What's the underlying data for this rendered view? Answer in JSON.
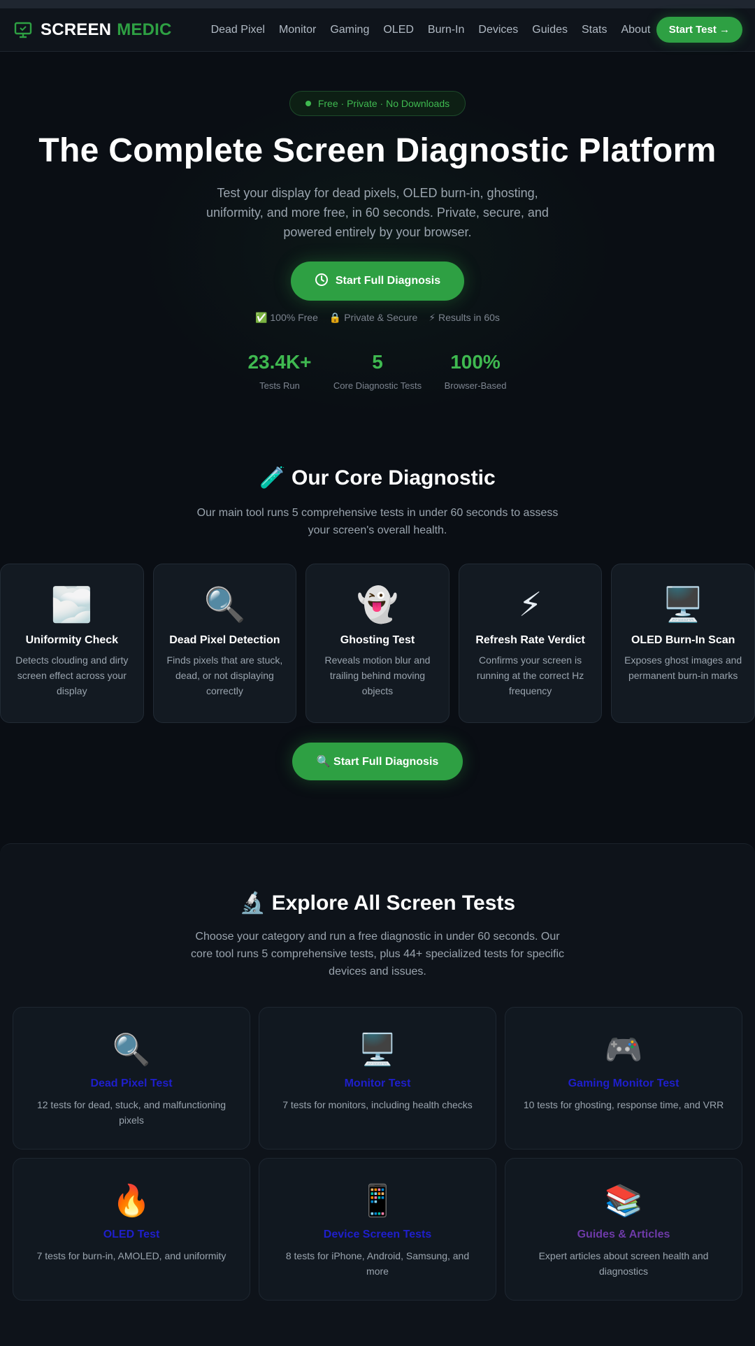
{
  "nav": {
    "brand_primary": "SCREEN",
    "brand_secondary": "MEDIC",
    "links": [
      "Dead Pixel",
      "Monitor",
      "Gaming",
      "OLED",
      "Burn-In",
      "Devices",
      "Guides",
      "Stats",
      "About"
    ],
    "cta": "Start Test →"
  },
  "hero": {
    "badge": "Free · Private · No Downloads",
    "title": "The Complete Screen Diagnostic Platform",
    "subtitle": "Test your display for dead pixels, OLED burn-in, ghosting, uniformity, and more free, in 60 seconds. Private, secure, and powered entirely by your browser.",
    "button": "Start Full Diagnosis",
    "trust": [
      "✅ 100% Free",
      "🔒 Private & Secure",
      "⚡ Results in 60s"
    ],
    "stats": [
      {
        "value": "23.4K+",
        "label": "Tests Run"
      },
      {
        "value": "5",
        "label": "Core Diagnostic Tests"
      },
      {
        "value": "100%",
        "label": "Browser-Based"
      }
    ]
  },
  "core": {
    "title": "🧪 Our Core Diagnostic",
    "subtitle": "Our main tool runs 5 comprehensive tests in under 60 seconds to assess your screen's overall health.",
    "cards": [
      {
        "emoji": "🌫️",
        "title": "Uniformity Check",
        "desc": "Detects clouding and dirty screen effect across your display"
      },
      {
        "emoji": "🔍",
        "title": "Dead Pixel Detection",
        "desc": "Finds pixels that are stuck, dead, or not displaying correctly"
      },
      {
        "emoji": "👻",
        "title": "Ghosting Test",
        "desc": "Reveals motion blur and trailing behind moving objects"
      },
      {
        "emoji": "⚡",
        "title": "Refresh Rate Verdict",
        "desc": "Confirms your screen is running at the correct Hz frequency"
      },
      {
        "emoji": "🖥️",
        "title": "OLED Burn-In Scan",
        "desc": "Exposes ghost images and permanent burn-in marks"
      }
    ],
    "button": "🔍 Start Full Diagnosis"
  },
  "explore": {
    "title": "🔬 Explore All Screen Tests",
    "subtitle": "Choose your category and run a free diagnostic in under 60 seconds. Our core tool runs 5 comprehensive tests, plus 44+ specialized tests for specific devices and issues.",
    "cards": [
      {
        "emoji": "🔍",
        "title": "Dead Pixel Test",
        "desc": "12 tests for dead, stuck, and malfunctioning pixels"
      },
      {
        "emoji": "🖥️",
        "title": "Monitor Test",
        "desc": "7 tests for monitors, including health checks"
      },
      {
        "emoji": "🎮",
        "title": "Gaming Monitor Test",
        "desc": "10 tests for ghosting, response time, and VRR"
      },
      {
        "emoji": "🔥",
        "title": "OLED Test",
        "desc": "7 tests for burn-in, AMOLED, and uniformity"
      },
      {
        "emoji": "📱",
        "title": "Device Screen Tests",
        "desc": "8 tests for iPhone, Android, Samsung, and more"
      },
      {
        "emoji": "📚",
        "title": "Guides & Articles",
        "desc": "Expert articles about screen health and diagnostics"
      }
    ]
  },
  "colors": {
    "accent": "#2ea043",
    "accent_text": "#3fb950",
    "background": "#0a0e14",
    "link": "#1f1fcc",
    "link_visited": "#6e3aa8"
  },
  "icons": {
    "brand": "monitor-icon",
    "hero_button": "clock-icon"
  }
}
